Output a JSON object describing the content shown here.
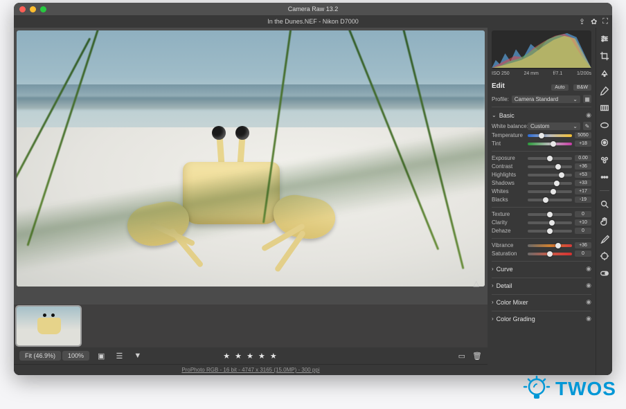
{
  "window": {
    "title": "Camera Raw 13.2"
  },
  "doc": {
    "filename": "In the Dunes.NEF  -  Nikon D7000"
  },
  "histogram": {
    "iso": "ISO 250",
    "focal": "24 mm",
    "aperture": "f/7.1",
    "shutter": "1/200s"
  },
  "edit": {
    "title": "Edit",
    "auto": "Auto",
    "bw": "B&W",
    "profile_label": "Profile:",
    "profile_value": "Camera Standard"
  },
  "basic": {
    "title": "Basic",
    "wb_label": "White balance:",
    "wb_value": "Custom",
    "temperature_label": "Temperature",
    "temperature_value": "5050",
    "tint_label": "Tint",
    "tint_value": "+18",
    "exposure_label": "Exposure",
    "exposure_value": "0.00",
    "contrast_label": "Contrast",
    "contrast_value": "+36",
    "highlights_label": "Highlights",
    "highlights_value": "+53",
    "shadows_label": "Shadows",
    "shadows_value": "+33",
    "whites_label": "Whites",
    "whites_value": "+17",
    "blacks_label": "Blacks",
    "blacks_value": "-19",
    "texture_label": "Texture",
    "texture_value": "0",
    "clarity_label": "Clarity",
    "clarity_value": "+10",
    "dehaze_label": "Dehaze",
    "dehaze_value": "0",
    "vibrance_label": "Vibrance",
    "vibrance_value": "+36",
    "saturation_label": "Saturation",
    "saturation_value": "0"
  },
  "sections": {
    "curve": "Curve",
    "detail": "Detail",
    "color_mixer": "Color Mixer",
    "color_grading": "Color Grading"
  },
  "footer": {
    "fit": "Fit (46.9%)",
    "zoom": "100%",
    "info": "ProPhoto RGB - 16 bit - 4747 x 3165 (15.0MP) - 300 ppi"
  },
  "stars": "★ ★ ★ ★ ★",
  "brand": "TWOS"
}
